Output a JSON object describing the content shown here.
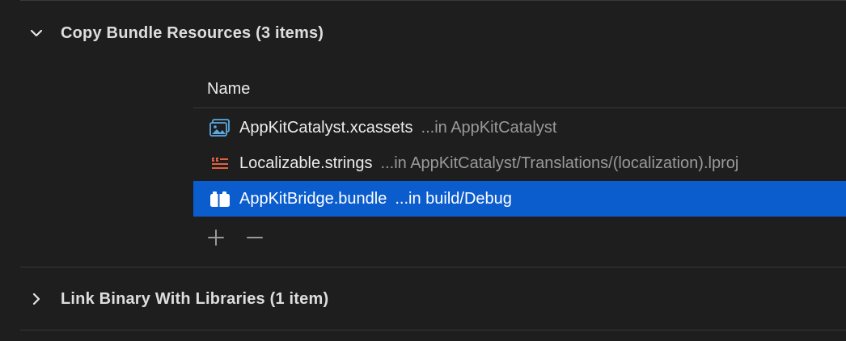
{
  "sections": [
    {
      "title": "Copy Bundle Resources (3 items)",
      "expanded": true,
      "disclosure_icon": "chevron-down-icon"
    },
    {
      "title": "Link Binary With Libraries (1 item)",
      "expanded": false,
      "disclosure_icon": "chevron-right-icon"
    }
  ],
  "table": {
    "column_header": "Name",
    "rows": [
      {
        "icon": "asset-catalog-icon",
        "name": "AppKitCatalyst.xcassets",
        "location": "...in AppKitCatalyst",
        "selected": false
      },
      {
        "icon": "strings-file-icon",
        "name": "Localizable.strings",
        "location": "...in AppKitCatalyst/Translations/(localization).lproj",
        "selected": false
      },
      {
        "icon": "bundle-icon",
        "name": "AppKitBridge.bundle",
        "location": "...in build/Debug",
        "selected": true
      }
    ]
  },
  "controls": {
    "add_label": "+",
    "remove_label": "—"
  },
  "colors": {
    "background": "#1f1e1f",
    "selection": "#0b5ccd",
    "divider": "#3a393a",
    "asset_icon": "#5aa8e0",
    "strings_icon": "#e2603f"
  }
}
